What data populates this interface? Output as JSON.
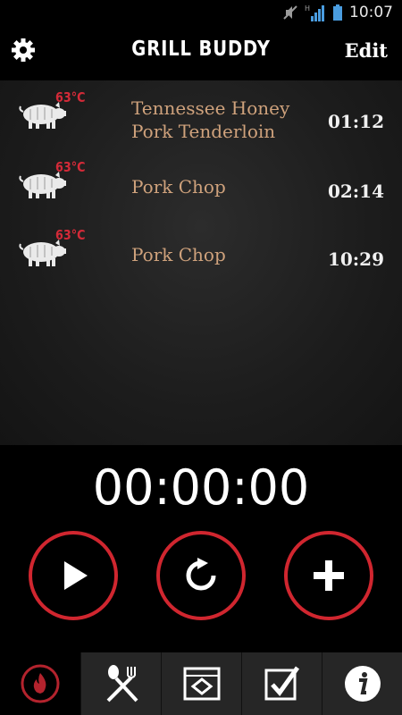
{
  "status_bar": {
    "time": "10:07",
    "network": "H"
  },
  "header": {
    "title": "GRILL BUDDY",
    "edit_label": "Edit"
  },
  "items": [
    {
      "temp": "63°C",
      "name": "Tennessee Honey Pork Tenderloin",
      "duration": "01:12"
    },
    {
      "temp": "63°C",
      "name": "Pork Chop",
      "duration": "02:14"
    },
    {
      "temp": "63°C",
      "name": "Pork Chop",
      "duration": "10:29"
    }
  ],
  "timer": {
    "display": "00:00:00"
  },
  "controls": [
    "play-icon",
    "reset-icon",
    "add-icon"
  ],
  "tabs": [
    "flame-icon",
    "utensils-icon",
    "grill-icon",
    "checklist-icon",
    "info-icon"
  ],
  "colors": {
    "accent": "#d0262f",
    "item_name": "#cfa27c",
    "temp": "#d32a38"
  }
}
